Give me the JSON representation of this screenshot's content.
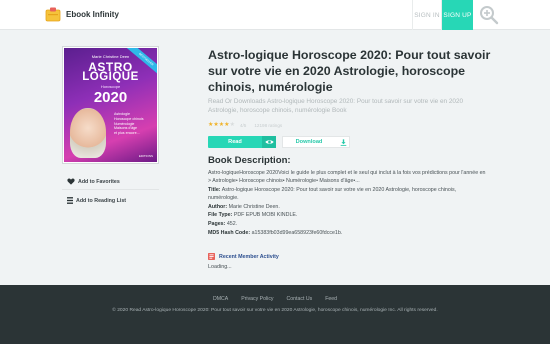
{
  "header": {
    "brand": "Ebook Infinity",
    "signin": "SIGN IN",
    "signup": "SIGN UP"
  },
  "cover": {
    "author": "Marie Christine Deen",
    "title_line1": "ASTRO",
    "title_line2": "LOGIQUE",
    "title_line3": "Horoscope",
    "title_line4": "2020",
    "lines": [
      "Astrologie",
      "Horoscope chinois",
      "Numérologie",
      "Maisons d'âge",
      "et plus encore..."
    ],
    "publisher": "EDITIONS",
    "ribbon": "BESTSELLER"
  },
  "sidebar": {
    "favorites": "Add to Favorites",
    "reading_list": "Add to Reading List"
  },
  "book": {
    "title": "Astro-logique Horoscope 2020: Pour tout savoir sur votre vie en 2020 Astrologie, horoscope chinois, numérologie",
    "subtitle": "Read Or Downloads Astro-logique Horoscope 2020: Pour tout savoir sur votre vie en 2020 Astrologie, horoscope chinois, numérologie Book",
    "rating_value": "4/5",
    "rating_count": "12198 ratings",
    "stars": 4,
    "read_label": "Read",
    "download_label": "Download"
  },
  "description": {
    "heading": "Book Description:",
    "text": "Astro-logiqueHoroscope 2020Voici le guide le plus complet et le seul qui inclut à la fois vos prédictions pour l'année en > Astrologie• Horoscope chinois• Numérologie• Maisons d'âge•...",
    "title_label": "Title:",
    "title_value": "Astro-logique Horoscope 2020: Pour tout savoir sur votre vie en 2020 Astrologie, horoscope chinois, numérologie.",
    "author_label": "Author:",
    "author_value": "Marie Christine Deen.",
    "filetype_label": "File Type:",
    "filetype_value": "PDF EPUB MOBI KINDLE.",
    "pages_label": "Pages:",
    "pages_value": "452.",
    "md5_label": "MD5 Hash Code:",
    "md5_value": "a15383fb03d99ea658923fe60fdcce1b."
  },
  "activity": {
    "label": "Recent Member Activity",
    "status": "Loading..."
  },
  "footer": {
    "links": [
      "DMCA",
      "Privacy Policy",
      "Contact Us",
      "Feed"
    ],
    "copyright": "© 2020 Read Astro-logique Horoscope 2020: Pour tout savoir sur votre vie en 2020 Astrologie, horoscope chinois, numérologie Inc. All rights reserved."
  },
  "colors": {
    "accent": "#27d7b6",
    "footer_bg": "#2b3436",
    "page_bg": "#f0f3f4",
    "star": "#f0b32a"
  }
}
